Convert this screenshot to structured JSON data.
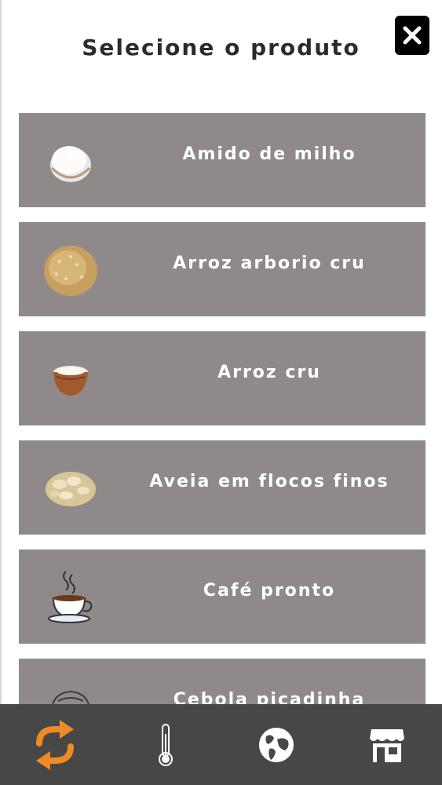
{
  "header": {
    "title": "Selecione o produto",
    "close_icon": "close-icon"
  },
  "products": [
    {
      "label": "Amido de milho",
      "icon": "cornstarch-bowl-icon"
    },
    {
      "label": "Arroz arborio cru",
      "icon": "arborio-rice-pile-icon"
    },
    {
      "label": "Arroz cru",
      "icon": "rice-bowl-icon"
    },
    {
      "label": "Aveia em flocos finos",
      "icon": "oat-flakes-icon"
    },
    {
      "label": "Café pronto",
      "icon": "coffee-cup-icon"
    },
    {
      "label": "Cebola picadinha",
      "icon": "onion-icon"
    }
  ],
  "tabbar": {
    "items": [
      {
        "name": "convert",
        "icon": "swap-arrows-icon",
        "active": true
      },
      {
        "name": "temperature",
        "icon": "thermometer-icon",
        "active": false
      },
      {
        "name": "globe",
        "icon": "globe-icon",
        "active": false
      },
      {
        "name": "store",
        "icon": "store-icon",
        "active": false
      }
    ]
  },
  "colors": {
    "row_bg": "#8f8989",
    "tabbar_bg": "#474747",
    "accent": "#f08a24",
    "title": "#2b2b2b"
  }
}
